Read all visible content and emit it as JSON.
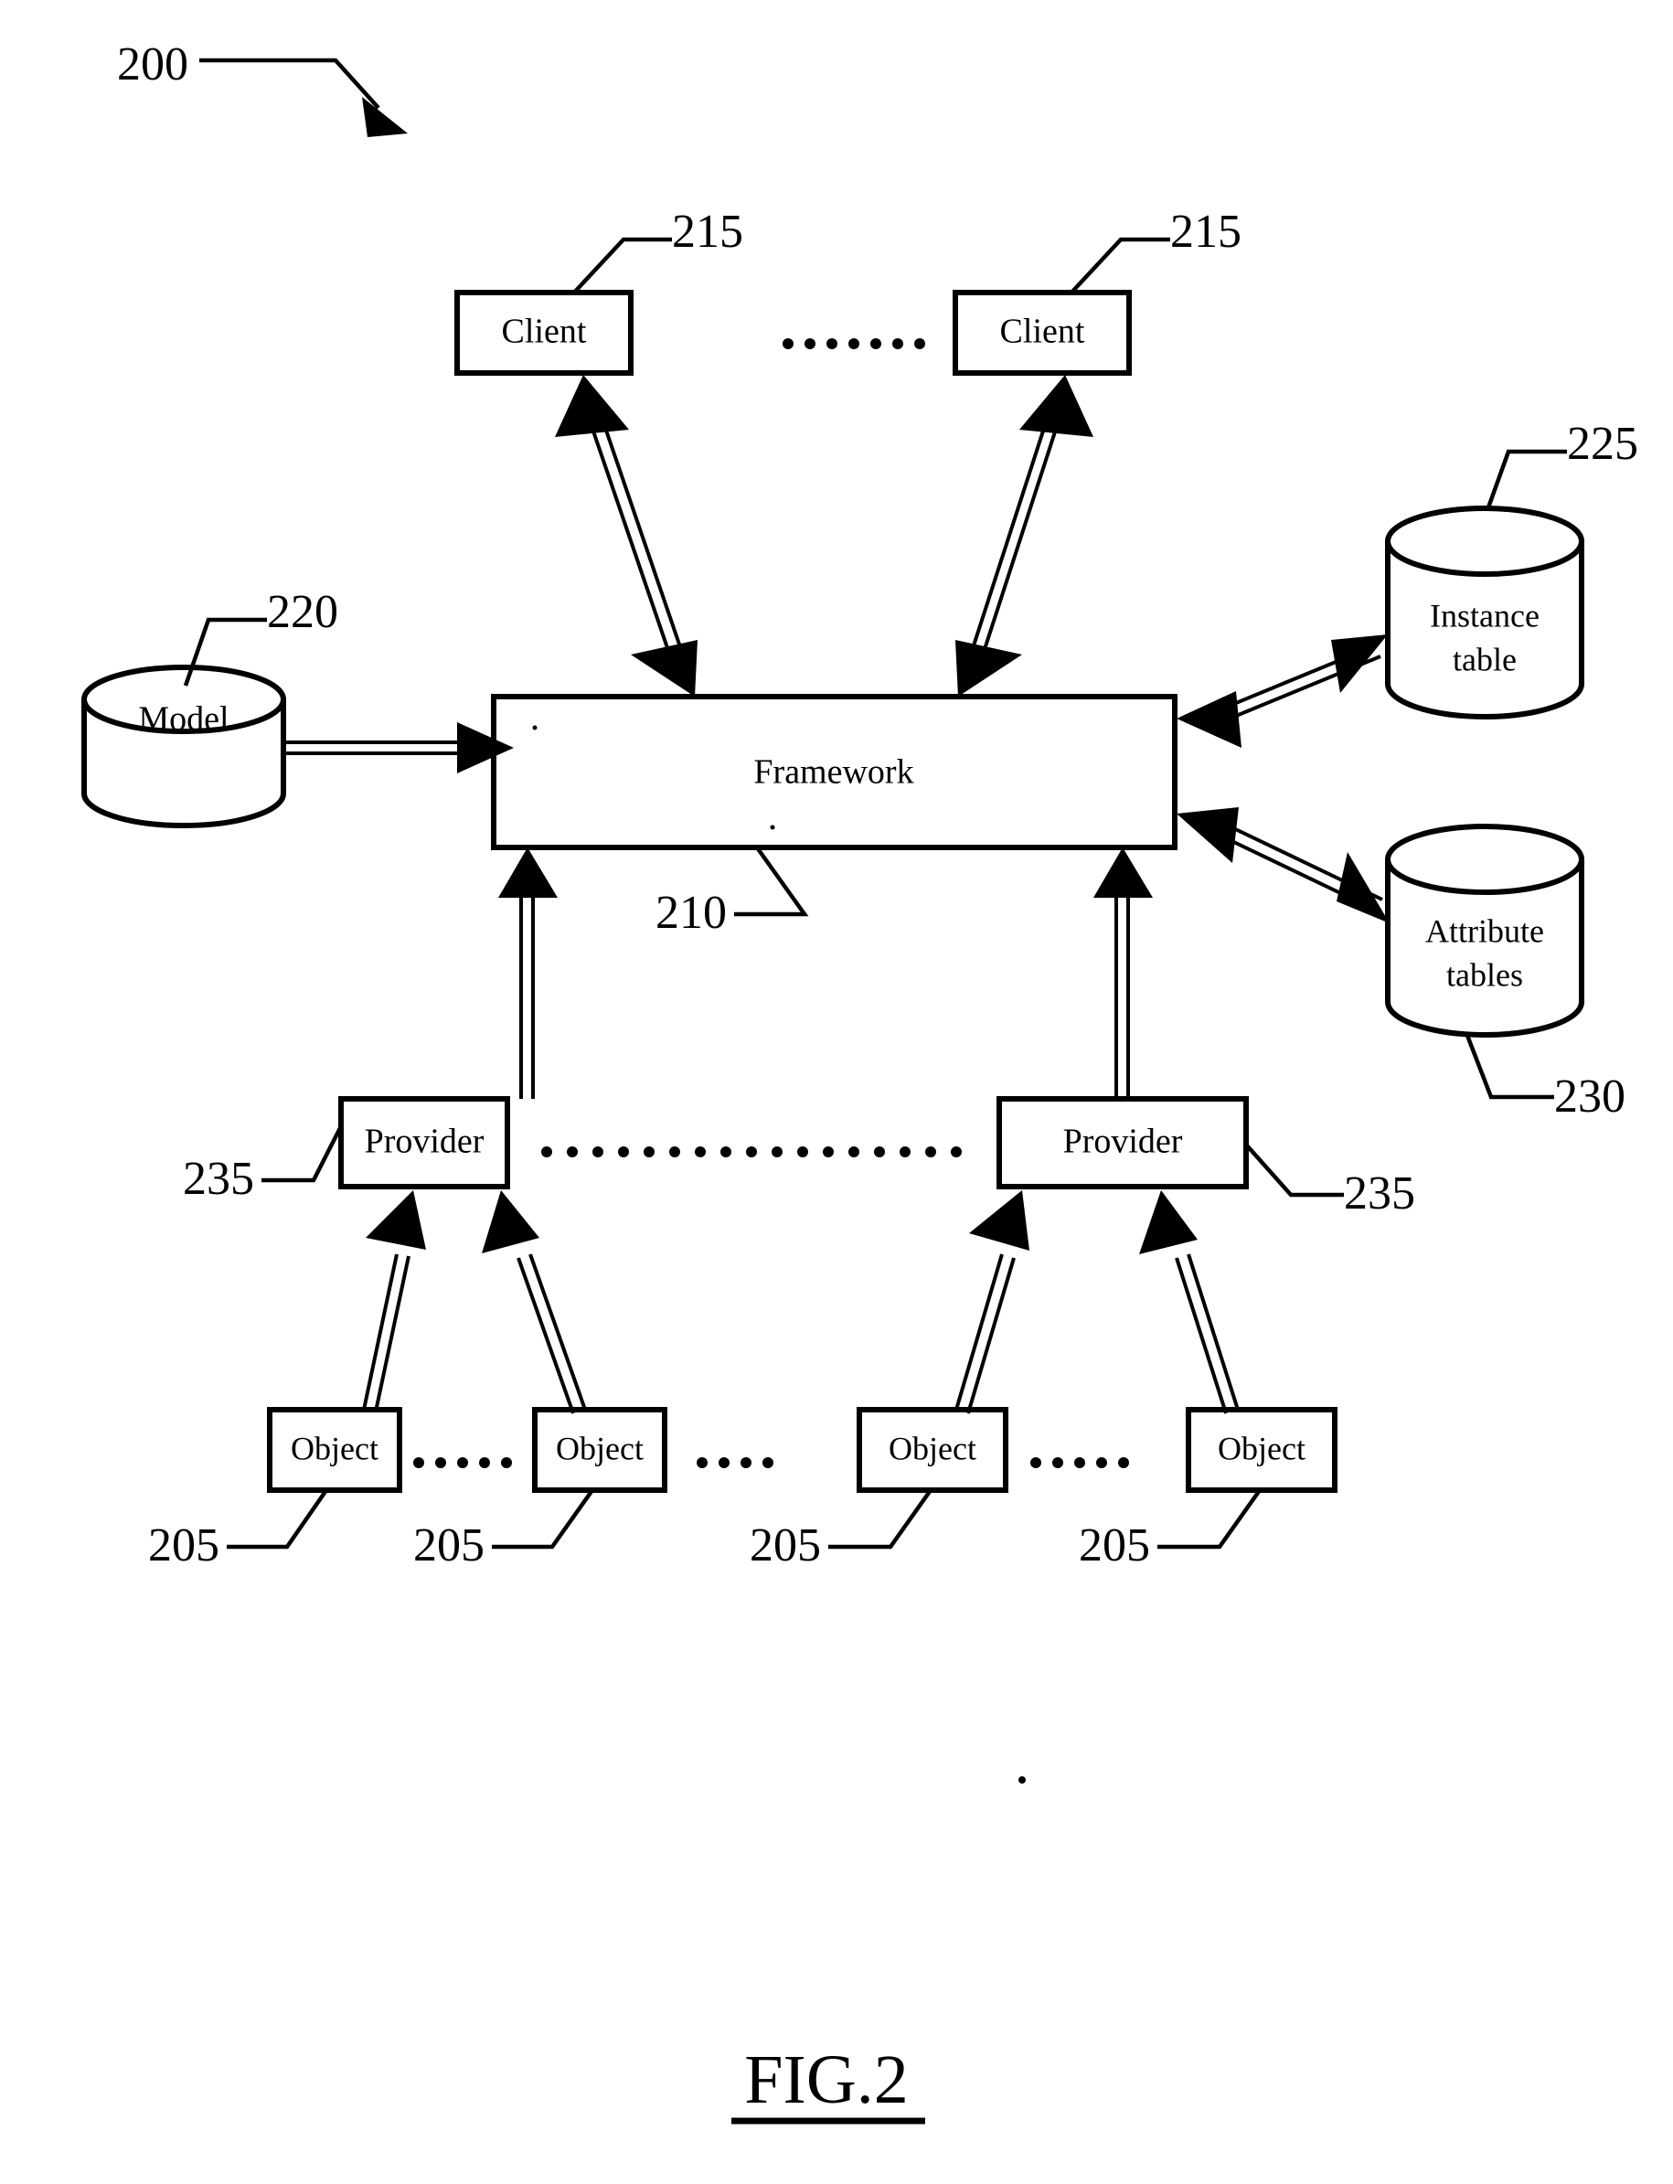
{
  "figure": {
    "caption": "FIG.2",
    "diagram_reference": "200"
  },
  "nodes": {
    "clients": [
      {
        "label": "Client",
        "ref": "215"
      },
      {
        "label": "Client",
        "ref": "215"
      }
    ],
    "framework": {
      "label": "Framework",
      "ref": "210"
    },
    "model": {
      "label": "Model",
      "ref": "220"
    },
    "instance_table": {
      "label_line1": "Instance",
      "label_line2": "table",
      "ref": "225"
    },
    "attribute_tables": {
      "label_line1": "Attribute",
      "label_line2": "tables",
      "ref": "230"
    },
    "providers": [
      {
        "label": "Provider",
        "ref": "235"
      },
      {
        "label": "Provider",
        "ref": "235"
      }
    ],
    "objects": [
      {
        "label": "Object",
        "ref": "205"
      },
      {
        "label": "Object",
        "ref": "205"
      },
      {
        "label": "Object",
        "ref": "205"
      },
      {
        "label": "Object",
        "ref": "205"
      }
    ]
  },
  "ellipses": {
    "clients_row": "…….",
    "providers_row": "………….",
    "objects_row_1": "…..",
    "objects_row_2": "….",
    "objects_row_3": "….."
  },
  "connections": [
    {
      "from": "model",
      "to": "framework",
      "direction": "one-way"
    },
    {
      "from": "client-1",
      "to": "framework",
      "direction": "two-way"
    },
    {
      "from": "client-2",
      "to": "framework",
      "direction": "two-way"
    },
    {
      "from": "framework",
      "to": "instance-table",
      "direction": "two-way"
    },
    {
      "from": "framework",
      "to": "attribute-tables",
      "direction": "two-way"
    },
    {
      "from": "provider-1",
      "to": "framework",
      "direction": "one-way"
    },
    {
      "from": "provider-2",
      "to": "framework",
      "direction": "one-way"
    },
    {
      "from": "object-1",
      "to": "provider-1",
      "direction": "one-way"
    },
    {
      "from": "object-2",
      "to": "provider-1",
      "direction": "one-way"
    },
    {
      "from": "object-3",
      "to": "provider-2",
      "direction": "one-way"
    },
    {
      "from": "object-4",
      "to": "provider-2",
      "direction": "one-way"
    }
  ],
  "colors": {
    "ink": "#000000",
    "paper": "#ffffff"
  }
}
